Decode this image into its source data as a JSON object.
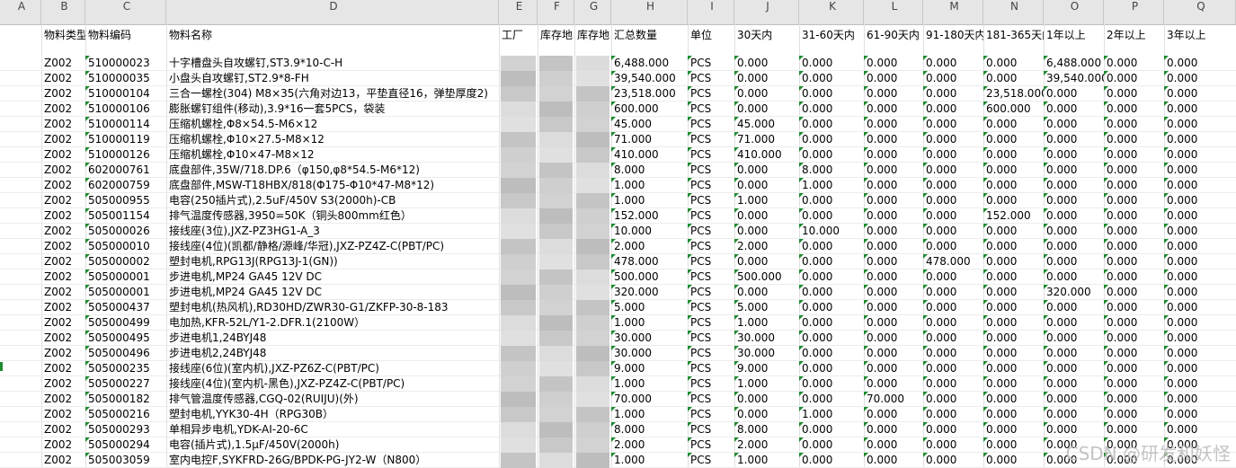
{
  "columns": [
    "A",
    "B",
    "C",
    "D",
    "E",
    "F",
    "G",
    "H",
    "I",
    "J",
    "K",
    "L",
    "M",
    "N",
    "O",
    "P",
    "Q"
  ],
  "headers": [
    "物料类型",
    "物料编码",
    "物料名称",
    "工厂",
    "库存地",
    "库存地",
    "汇总数量",
    "单位",
    "30天内",
    "31-60天内",
    "61-90天内",
    "91-180天内",
    "181-365天内",
    "1年以上",
    "2年以上",
    "3年以上"
  ],
  "rows": [
    [
      "Z002",
      "510000023",
      "十字槽盘头自攻螺钉,ST3.9*10-C-H",
      "6,488.000",
      "PCS",
      "0.000",
      "0.000",
      "0.000",
      "0.000",
      "0.000",
      "6,488.000",
      "0.000",
      "0.000"
    ],
    [
      "Z002",
      "510000035",
      "小盘头自攻螺钉,ST2.9*8-FH",
      "39,540.000",
      "PCS",
      "0.000",
      "0.000",
      "0.000",
      "0.000",
      "0.000",
      "39,540.000",
      "0.000",
      "0.000"
    ],
    [
      "Z002",
      "510000104",
      "三合一螺栓(304) M8×35(六角对边13，平垫直径16，弹垫厚度2)",
      "23,518.000",
      "PCS",
      "0.000",
      "0.000",
      "0.000",
      "0.000",
      "23,518.000",
      "0.000",
      "0.000",
      "0.000"
    ],
    [
      "Z002",
      "510000106",
      "膨胀螺钉组件(移动),3.9*16一套5PCS，袋装",
      "600.000",
      "PCS",
      "0.000",
      "0.000",
      "0.000",
      "0.000",
      "600.000",
      "0.000",
      "0.000",
      "0.000"
    ],
    [
      "Z002",
      "510000114",
      "压缩机螺栓,Φ8×54.5-M6×12",
      "45.000",
      "PCS",
      "45.000",
      "0.000",
      "0.000",
      "0.000",
      "0.000",
      "0.000",
      "0.000",
      "0.000"
    ],
    [
      "Z002",
      "510000119",
      "压缩机螺栓,Φ10×27.5-M8×12",
      "71.000",
      "PCS",
      "71.000",
      "0.000",
      "0.000",
      "0.000",
      "0.000",
      "0.000",
      "0.000",
      "0.000"
    ],
    [
      "Z002",
      "510000126",
      "压缩机螺栓,Φ10×47-M8×12",
      "410.000",
      "PCS",
      "410.000",
      "0.000",
      "0.000",
      "0.000",
      "0.000",
      "0.000",
      "0.000",
      "0.000"
    ],
    [
      "Z002",
      "602000761",
      "底盘部件,35W/718.DP.6（φ150,φ8*54.5-M6*12)",
      "8.000",
      "PCS",
      "0.000",
      "8.000",
      "0.000",
      "0.000",
      "0.000",
      "0.000",
      "0.000",
      "0.000"
    ],
    [
      "Z002",
      "602000759",
      "底盘部件,MSW-T18HBX/818(Φ175-Φ10*47-M8*12)",
      "1.000",
      "PCS",
      "0.000",
      "1.000",
      "0.000",
      "0.000",
      "0.000",
      "0.000",
      "0.000",
      "0.000"
    ],
    [
      "Z002",
      "505000955",
      "电容(250插片式),2.5uF/450V S3(2000h)-CB",
      "1.000",
      "PCS",
      "1.000",
      "0.000",
      "0.000",
      "0.000",
      "0.000",
      "0.000",
      "0.000",
      "0.000"
    ],
    [
      "Z002",
      "505001154",
      "排气温度传感器,3950=50K（铜头800mm红色）",
      "152.000",
      "PCS",
      "0.000",
      "0.000",
      "0.000",
      "0.000",
      "152.000",
      "0.000",
      "0.000",
      "0.000"
    ],
    [
      "Z002",
      "505000026",
      "接线座(3位),JXZ-PZ3HG1-A_3",
      "10.000",
      "PCS",
      "0.000",
      "10.000",
      "0.000",
      "0.000",
      "0.000",
      "0.000",
      "0.000",
      "0.000"
    ],
    [
      "Z002",
      "505000010",
      "接线座(4位)(凯都/静格/源峰/华冠),JXZ-PZ4Z-C(PBT/PC)",
      "2.000",
      "PCS",
      "2.000",
      "0.000",
      "0.000",
      "0.000",
      "0.000",
      "0.000",
      "0.000",
      "0.000"
    ],
    [
      "Z002",
      "505000002",
      "塑封电机,RPG13J(RPG13J-1(GN))",
      "478.000",
      "PCS",
      "0.000",
      "0.000",
      "0.000",
      "478.000",
      "0.000",
      "0.000",
      "0.000",
      "0.000"
    ],
    [
      "Z002",
      "505000001",
      "步进电机,MP24 GA45 12V DC",
      "500.000",
      "PCS",
      "500.000",
      "0.000",
      "0.000",
      "0.000",
      "0.000",
      "0.000",
      "0.000",
      "0.000"
    ],
    [
      "Z002",
      "505000001",
      "步进电机,MP24 GA45 12V DC",
      "320.000",
      "PCS",
      "0.000",
      "0.000",
      "0.000",
      "0.000",
      "0.000",
      "320.000",
      "0.000",
      "0.000"
    ],
    [
      "Z002",
      "505000437",
      "塑封电机(热风机),RD30HD/ZWR30-G1/ZKFP-30-8-183",
      "5.000",
      "PCS",
      "5.000",
      "0.000",
      "0.000",
      "0.000",
      "0.000",
      "0.000",
      "0.000",
      "0.000"
    ],
    [
      "Z002",
      "505000499",
      "电加热,KFR-52L/Y1-2.DFR.1(2100W）",
      "1.000",
      "PCS",
      "1.000",
      "0.000",
      "0.000",
      "0.000",
      "0.000",
      "0.000",
      "0.000",
      "0.000"
    ],
    [
      "Z002",
      "505000495",
      "步进电机1,24BYJ48",
      "30.000",
      "PCS",
      "30.000",
      "0.000",
      "0.000",
      "0.000",
      "0.000",
      "0.000",
      "0.000",
      "0.000"
    ],
    [
      "Z002",
      "505000496",
      "步进电机2,24BYJ48",
      "30.000",
      "PCS",
      "30.000",
      "0.000",
      "0.000",
      "0.000",
      "0.000",
      "0.000",
      "0.000",
      "0.000"
    ],
    [
      "Z002",
      "505000235",
      "接线座(6位)(室内机),JXZ-PZ6Z-C(PBT/PC)",
      "9.000",
      "PCS",
      "9.000",
      "0.000",
      "0.000",
      "0.000",
      "0.000",
      "0.000",
      "0.000",
      "0.000"
    ],
    [
      "Z002",
      "505000227",
      "接线座(4位)(室内机-黑色),JXZ-PZ4Z-C(PBT/PC)",
      "1.000",
      "PCS",
      "1.000",
      "0.000",
      "0.000",
      "0.000",
      "0.000",
      "0.000",
      "0.000",
      "0.000"
    ],
    [
      "Z002",
      "505000182",
      "排气管温度传感器,CGQ-02(RUIJU)(外)",
      "70.000",
      "PCS",
      "0.000",
      "0.000",
      "70.000",
      "0.000",
      "0.000",
      "0.000",
      "0.000",
      "0.000"
    ],
    [
      "Z002",
      "505000216",
      "塑封电机,YYK30-4H（RPG30B）",
      "1.000",
      "PCS",
      "0.000",
      "1.000",
      "0.000",
      "0.000",
      "0.000",
      "0.000",
      "0.000",
      "0.000"
    ],
    [
      "Z002",
      "505000293",
      "单相异步电机,YDK-AI-20-6C",
      "8.000",
      "PCS",
      "8.000",
      "0.000",
      "0.000",
      "0.000",
      "0.000",
      "0.000",
      "0.000",
      "0.000"
    ],
    [
      "Z002",
      "505000294",
      "电容(插片式),1.5μF/450V(2000h)",
      "2.000",
      "PCS",
      "2.000",
      "0.000",
      "0.000",
      "0.000",
      "0.000",
      "0.000",
      "0.000",
      "0.000"
    ],
    [
      "Z002",
      "505003059",
      "室内电控F,SYKFRD-26G/BPDK-PG-JY2-W（N800）",
      "1.000",
      "PCS",
      "1.000",
      "0.000",
      "0.000",
      "0.000",
      "0.000",
      "0.000",
      "0.000",
      "0.000"
    ]
  ],
  "watermark": "CSDN @研发和妖怪",
  "blur_color": "#c9c9c9"
}
